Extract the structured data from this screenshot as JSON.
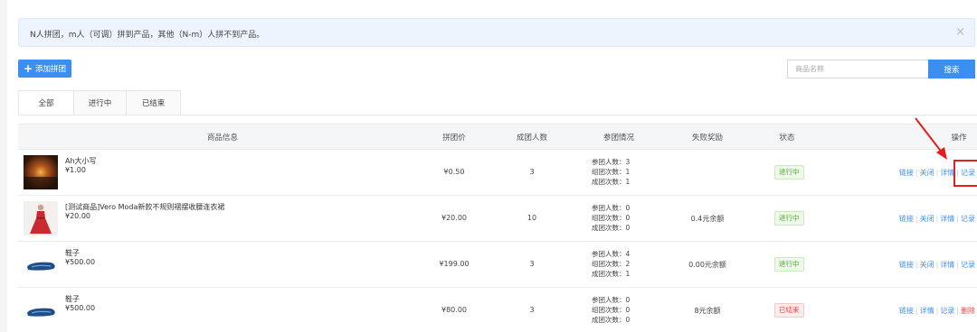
{
  "notice": {
    "text": "N人拼团，m人（可调）拼到产品，其他（N-m）人拼不到产品。",
    "close": "×"
  },
  "toolbar": {
    "add_label": "添加拼团",
    "add_icon": "plus-icon",
    "search_placeholder": "商品名称",
    "search_label": "搜索"
  },
  "tabs": [
    {
      "label": "全部",
      "active": true
    },
    {
      "label": "进行中",
      "active": false
    },
    {
      "label": "已结束",
      "active": false
    }
  ],
  "table": {
    "headers": [
      "商品信息",
      "拼团价",
      "成团人数",
      "参团情况",
      "失败奖励",
      "状态",
      "操作"
    ],
    "rows": [
      {
        "name": "Ah大小写",
        "price": "¥1.00",
        "group_price": "¥0.50",
        "size": "3",
        "stats": [
          "参团人数：3",
          "组团次数：1",
          "成团次数：1"
        ],
        "reward": "",
        "status": "进行中",
        "status_type": "running",
        "actions": [
          "链接",
          "关闭",
          "详情",
          "记录"
        ]
      },
      {
        "name": "[测试商品]Vero Moda新款不规则褶摆收腰连衣裙",
        "price": "¥20.00",
        "group_price": "¥20.00",
        "size": "10",
        "stats": [
          "参团人数：0",
          "组团次数：0",
          "成团次数：0"
        ],
        "reward": "0.4元余额",
        "status": "进行中",
        "status_type": "running",
        "actions": [
          "链接",
          "关闭",
          "详情",
          "记录"
        ]
      },
      {
        "name": "鞋子",
        "price": "¥500.00",
        "group_price": "¥199.00",
        "size": "3",
        "stats": [
          "参团人数：4",
          "组团次数：2",
          "成团次数：1"
        ],
        "reward": "0.00元余额",
        "status": "进行中",
        "status_type": "running",
        "actions": [
          "链接",
          "关闭",
          "详情",
          "记录"
        ]
      },
      {
        "name": "鞋子",
        "price": "¥500.00",
        "group_price": "¥80.00",
        "size": "3",
        "stats": [
          "参团人数：0",
          "组团次数：0",
          "成团次数：0"
        ],
        "reward": "8元余额",
        "status": "已结束",
        "status_type": "ended",
        "actions": [
          "链接",
          "详情",
          "记录",
          "删除"
        ]
      }
    ]
  },
  "colors": {
    "accent": "#3b8ff0",
    "running": "#4eab32",
    "ended": "#e54545",
    "annotation": "#e02020"
  }
}
